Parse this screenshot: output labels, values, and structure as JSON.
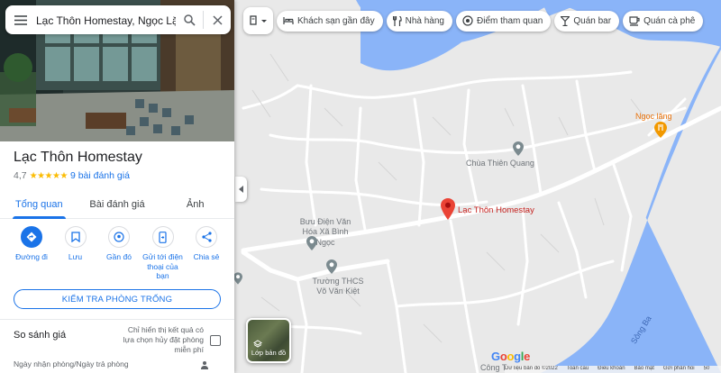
{
  "search": {
    "value": "Lạc Thôn Homestay, Ngọc Lặng"
  },
  "place": {
    "name": "Lạc Thôn Homestay",
    "rating": "4,7",
    "stars": "★★★★★",
    "reviews": "9 bài đánh giá"
  },
  "tabs": [
    {
      "label": "Tổng quan",
      "active": true
    },
    {
      "label": "Bài đánh giá"
    },
    {
      "label": "Ảnh"
    }
  ],
  "actions": [
    {
      "label": "Đường đi",
      "icon": "directions-icon"
    },
    {
      "label": "Lưu",
      "icon": "bookmark-icon"
    },
    {
      "label": "Gần đó",
      "icon": "nearby-icon"
    },
    {
      "label": "Gửi tới điện thoại của bạn",
      "icon": "send-to-phone-icon"
    },
    {
      "label": "Chia sẻ",
      "icon": "share-icon"
    }
  ],
  "check_rooms": "KIỂM TRA PHÒNG TRỐNG",
  "compare": {
    "title": "So sánh giá",
    "refund_note": "Chỉ hiển thị kết quả có lựa chọn hủy đặt phòng miễn phí",
    "dates_label": "Ngày nhận phòng/Ngày trả phòng"
  },
  "chips": [
    {
      "label": "Khách sạn gần đây",
      "icon": "bed-icon"
    },
    {
      "label": "Nhà hàng",
      "icon": "restaurant-icon"
    },
    {
      "label": "Điểm tham quan",
      "icon": "attraction-icon"
    },
    {
      "label": "Quán bar",
      "icon": "bar-icon"
    },
    {
      "label": "Quán cà phê",
      "icon": "cafe-icon"
    }
  ],
  "map": {
    "labels": {
      "ngoc_lang": "Ngọc lăng",
      "chua": "Chùa Thiên Quang",
      "homestay": "Lạc Thôn Homestay",
      "buu_dien": "Bưu Điện Văn Hóa Xã Bình Ngọc",
      "truong": "Trường THCS Võ Văn Kiệt",
      "song_ba": "Sông Ba",
      "cong_ty": "Công T"
    },
    "layers_label": "Lớp bản đồ",
    "google": "Google",
    "footer": [
      "Dữ liệu bản đồ ©2022",
      "Toàn cầu",
      "Điều khoản",
      "Bảo mật",
      "Gửi phản hồi",
      "50"
    ]
  },
  "colors": {
    "accent": "#1a73e8",
    "pin": "#ea4335",
    "river": "#8ab4f8",
    "star": "#fbbc04"
  }
}
